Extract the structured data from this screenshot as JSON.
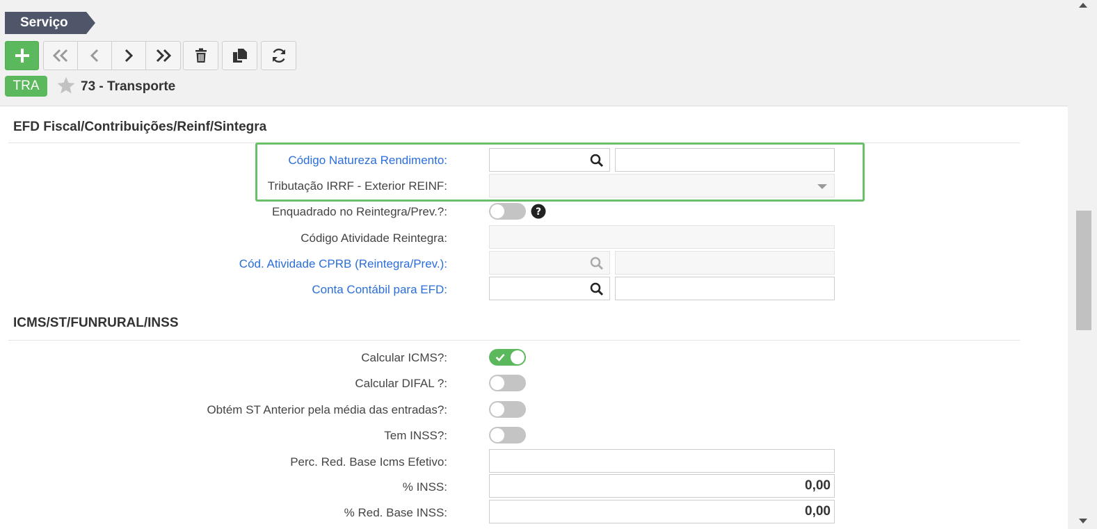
{
  "header": {
    "title": "Serviço",
    "badge": "TRA",
    "record_title": "73 - Transporte"
  },
  "toolbar": {
    "add": "plus-icon",
    "first": "double-chevron-left-icon",
    "prev": "chevron-left-icon",
    "next": "chevron-right-icon",
    "last": "double-chevron-right-icon",
    "delete": "trash-icon",
    "copy": "copy-icon",
    "refresh": "refresh-icon"
  },
  "sections": {
    "efd": {
      "title": "EFD Fiscal/Contribuições/Reinf/Sintegra",
      "fields": {
        "codigo_natureza": {
          "label": "Código Natureza Rendimento:",
          "value": "",
          "desc": ""
        },
        "tributacao_irrf": {
          "label": "Tributação IRRF - Exterior REINF:",
          "value": ""
        },
        "enquadrado": {
          "label": "Enquadrado no Reintegra/Prev.?:",
          "checked": false
        },
        "codigo_atividade": {
          "label": "Código Atividade Reintegra:",
          "value": ""
        },
        "cod_atividade_cprb": {
          "label": "Cód. Atividade CPRB (Reintegra/Prev.):",
          "value": "",
          "desc": ""
        },
        "conta_contabil": {
          "label": "Conta Contábil para EFD:",
          "value": "",
          "desc": ""
        }
      }
    },
    "icms": {
      "title": "ICMS/ST/FUNRURAL/INSS",
      "fields": {
        "calcular_icms": {
          "label": "Calcular ICMS?:",
          "checked": true
        },
        "calcular_difal": {
          "label": "Calcular DIFAL ?:",
          "checked": false
        },
        "obtem_st": {
          "label": "Obtém ST Anterior pela média das entradas?:",
          "checked": false
        },
        "tem_inss": {
          "label": "Tem INSS?:",
          "checked": false
        },
        "perc_red_base": {
          "label": "Perc. Red. Base Icms Efetivo:",
          "value": ""
        },
        "perc_inss": {
          "label": "% INSS:",
          "value": "0,00"
        },
        "red_base_inss": {
          "label": "% Red. Base INSS:",
          "value": "0,00"
        }
      }
    }
  },
  "colors": {
    "primary_green": "#5cb85c",
    "link_blue": "#2a6edb",
    "header_tag": "#4f5669",
    "highlight": "#6abf69"
  }
}
